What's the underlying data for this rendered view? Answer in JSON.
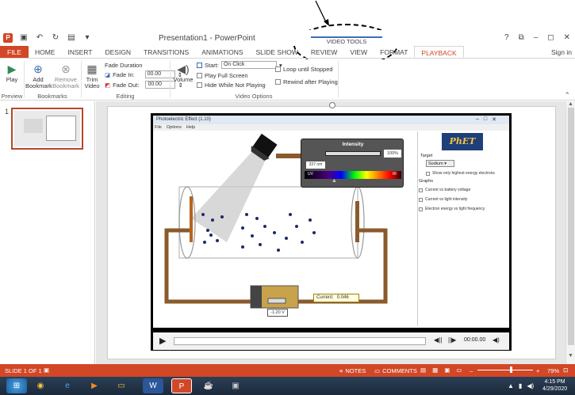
{
  "window": {
    "title": "Presentation1 - PowerPoint",
    "controls": [
      "?",
      "⧉",
      "–",
      "◻",
      "✕"
    ],
    "sign_in": "Sign in"
  },
  "contextual_tab_group": "VIDEO TOOLS",
  "tabs": [
    "FILE",
    "HOME",
    "INSERT",
    "DESIGN",
    "TRANSITIONS",
    "ANIMATIONS",
    "SLIDE SHOW",
    "REVIEW",
    "VIEW",
    "FORMAT",
    "PLAYBACK"
  ],
  "active_tab": "PLAYBACK",
  "ribbon": {
    "preview": {
      "group": "Preview",
      "play": "Play"
    },
    "bookmarks": {
      "group": "Bookmarks",
      "add": "Add Bookmark",
      "remove": "Remove Bookmark"
    },
    "editing": {
      "group": "Editing",
      "trim": "Trim Video",
      "fade_duration": "Fade Duration",
      "fade_in_label": "Fade In:",
      "fade_in_value": "00.00",
      "fade_out_label": "Fade Out:",
      "fade_out_value": "00.00"
    },
    "video_options": {
      "group": "Video Options",
      "volume": "Volume",
      "start_label": "Start:",
      "start_value": "On Click",
      "play_full_screen": "Play Full Screen",
      "hide_while_not_playing": "Hide While Not Playing",
      "loop_until_stopped": "Loop until Stopped",
      "rewind_after_playing": "Rewind after Playing"
    }
  },
  "slides_pane": {
    "slide_number": "1"
  },
  "phet": {
    "window_title": "Photoelectric Effect (1.10)",
    "menu": [
      "File",
      "Options",
      "Help"
    ],
    "intensity_label": "Intensity",
    "intensity_value": "100%",
    "wavelength_value": "337 nm",
    "uv_label": "UV",
    "ir_label": "IR",
    "current_label": "Current:",
    "current_value": "0.046",
    "voltage_value": "-1.20 V",
    "logo_text": "PhET",
    "target_label": "Target",
    "target_value": "Sodium",
    "show_highest": "Show only highest energy electrons",
    "graphs_label": "Graphs",
    "graph_options": [
      "Current vs battery voltage",
      "Current vs light intensity",
      "Electron energy vs light frequency"
    ]
  },
  "player": {
    "time": "00:00.00"
  },
  "status": {
    "slide_info": "SLIDE 1 OF 1",
    "notes": "NOTES",
    "comments": "COMMENTS",
    "zoom": "79%"
  },
  "taskbar": {
    "time": "4:15 PM",
    "date": "4/29/2020"
  }
}
